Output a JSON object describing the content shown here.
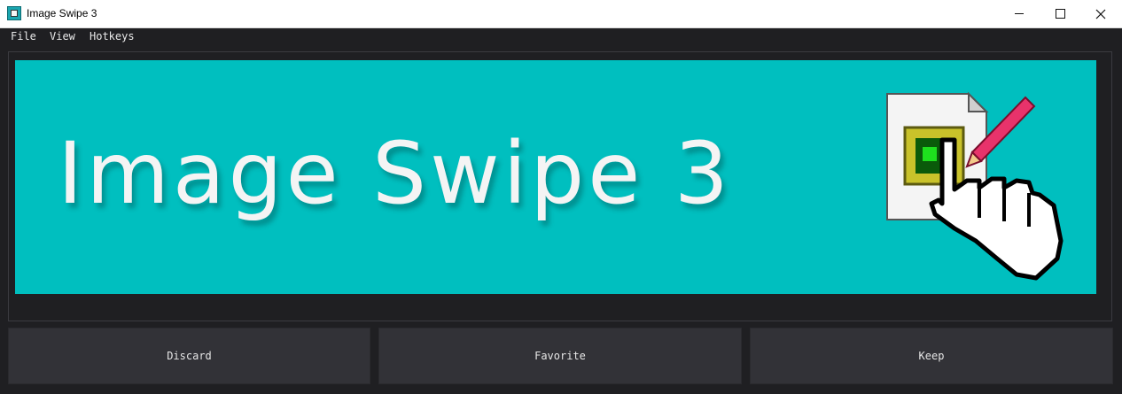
{
  "window": {
    "title": "Image Swipe 3",
    "icon": "app-icon"
  },
  "menu": {
    "items": [
      "File",
      "View",
      "Hotkeys"
    ]
  },
  "image": {
    "banner_text": "Image Swipe 3",
    "background_color": "#00bfbf",
    "art": "image-with-pencil-and-pointer-hand-icon"
  },
  "buttons": {
    "discard": "Discard",
    "favorite": "Favorite",
    "keep": "Keep"
  }
}
